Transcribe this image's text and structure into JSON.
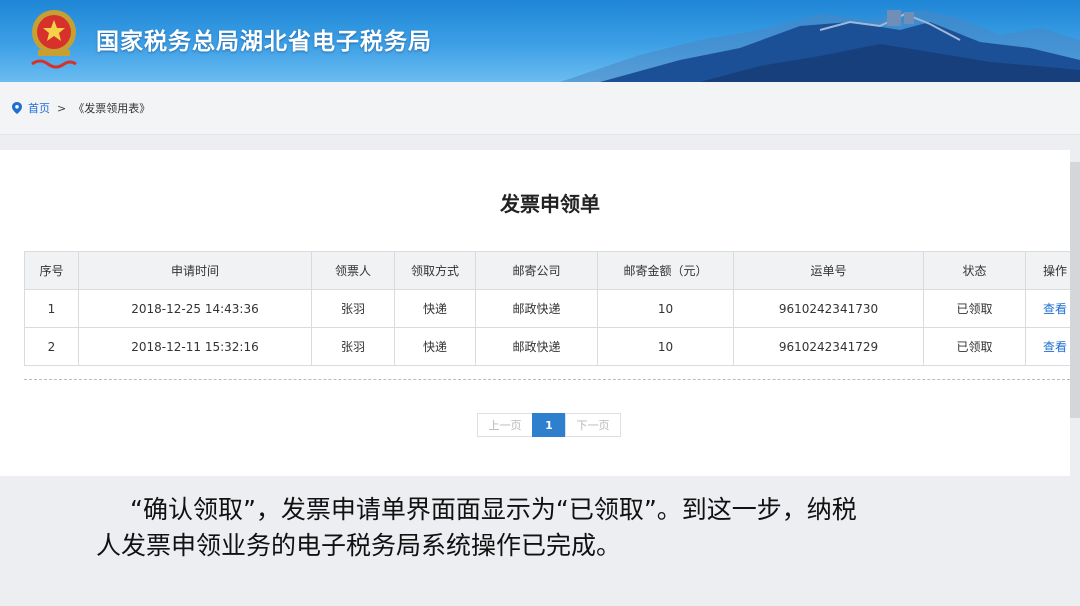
{
  "header": {
    "title": "国家税务总局湖北省电子税务局",
    "colors": {
      "sky": "#3da0e6",
      "mountain": "#1b4f96"
    }
  },
  "breadcrumb": {
    "icon": "map-pin-icon",
    "home": "首页",
    "separator": ">",
    "current": "《发票领用表》"
  },
  "form": {
    "title": "发票申领单",
    "columns": [
      "序号",
      "申请时间",
      "领票人",
      "领取方式",
      "邮寄公司",
      "邮寄金额（元）",
      "运单号",
      "状态",
      "操作"
    ],
    "rows": [
      {
        "seq": "1",
        "time": "2018-12-25 14:43:36",
        "recipient": "张羽",
        "method": "快递",
        "company": "邮政快递",
        "amount": "10",
        "tracking": "9610242341730",
        "status": "已领取",
        "action": "查看"
      },
      {
        "seq": "2",
        "time": "2018-12-11 15:32:16",
        "recipient": "张羽",
        "method": "快递",
        "company": "邮政快递",
        "amount": "10",
        "tracking": "9610242341729",
        "status": "已领取",
        "action": "查看"
      }
    ]
  },
  "pagination": {
    "prev": "上一页",
    "current": "1",
    "next": "下一页",
    "active_color": "#2f7fcf"
  },
  "caption": {
    "line1": "“确认领取”，发票申请单界面面显示为“已领取”。到这一步，纳税",
    "line2": "人发票申领业务的电子税务局系统操作已完成。"
  }
}
